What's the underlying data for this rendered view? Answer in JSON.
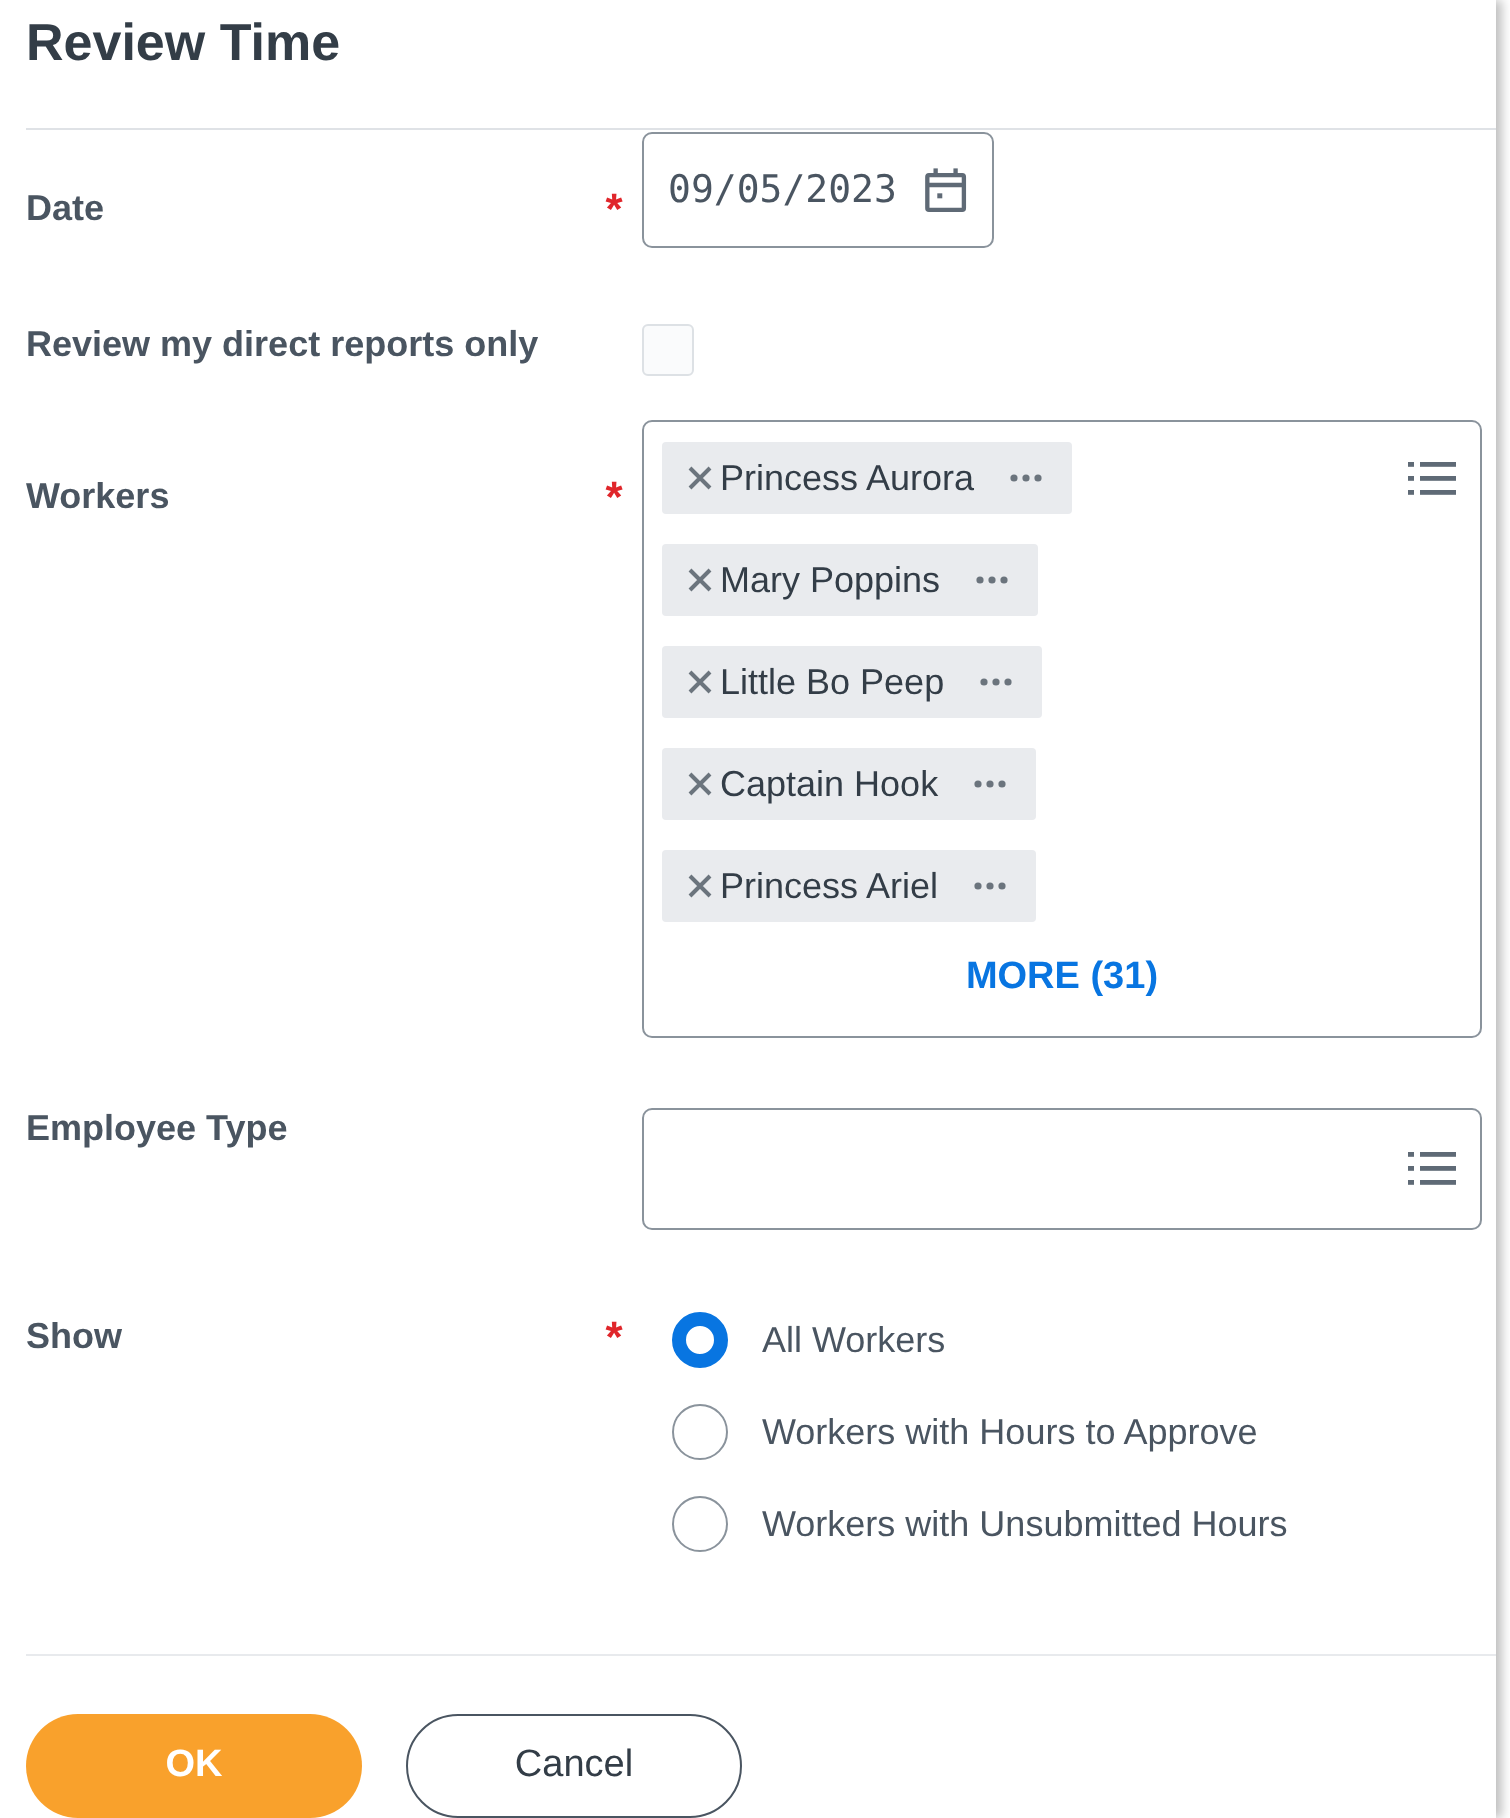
{
  "title": "Review Time",
  "fields": [
    {
      "kind": "date",
      "label": "Date",
      "required_mark": "*",
      "value": "09/05/2023"
    },
    {
      "kind": "checkbox",
      "label": "Review my direct reports only",
      "checked": false
    },
    {
      "kind": "multiselect",
      "label": "Workers",
      "required_mark": "*",
      "chips": [
        "Princess Aurora",
        "Mary Poppins",
        "Little Bo Peep",
        "Captain Hook",
        "Princess Ariel"
      ],
      "more": "MORE (31)"
    },
    {
      "kind": "select",
      "label": "Employee Type"
    },
    {
      "kind": "radio",
      "label": "Show",
      "required_mark": "*",
      "options": [
        {
          "label": "All Workers",
          "selected": true
        },
        {
          "label": "Workers with Hours to Approve",
          "selected": false
        },
        {
          "label": "Workers with Unsubmitted Hours",
          "selected": false
        }
      ]
    }
  ],
  "buttons": [
    {
      "label": "OK",
      "kind": "primary"
    },
    {
      "label": "Cancel",
      "kind": "secondary"
    }
  ]
}
